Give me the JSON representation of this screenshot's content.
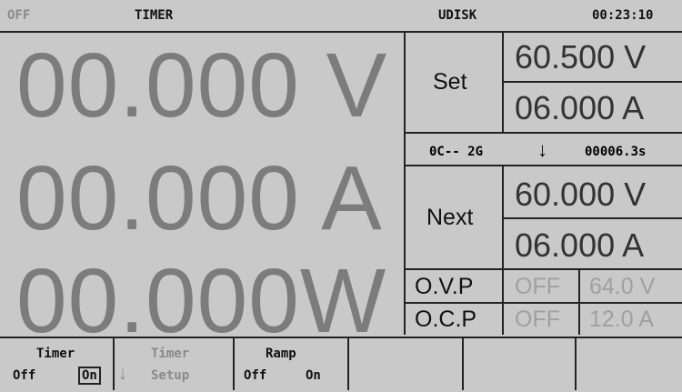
{
  "status": {
    "output_state": "OFF",
    "mode": "TIMER",
    "storage": "UDISK",
    "clock": "00:23:10"
  },
  "readings": {
    "voltage": "00.000 V",
    "current": "00.000 A",
    "power": "00.000W"
  },
  "set": {
    "label": "Set",
    "voltage": "60.500 V",
    "current": "06.000 A"
  },
  "sequence": {
    "step": "0C-- 2G",
    "direction_icon": "arrow-down-icon",
    "elapsed": "00006.3s"
  },
  "next": {
    "label": "Next",
    "voltage": "60.000 V",
    "current": "06.000 A"
  },
  "ovp": {
    "label": "O.V.P",
    "state": "OFF",
    "value": "64.0 V"
  },
  "ocp": {
    "label": "O.C.P",
    "state": "OFF",
    "value": "12.0 A"
  },
  "softkeys": {
    "timer": {
      "title": "Timer",
      "off": "Off",
      "on": "On",
      "selected": "On"
    },
    "timer_setup": {
      "title": "Timer",
      "subtitle": "Setup",
      "icon": "arrow-down-icon"
    },
    "ramp": {
      "title": "Ramp",
      "off": "Off",
      "on": "On"
    }
  }
}
